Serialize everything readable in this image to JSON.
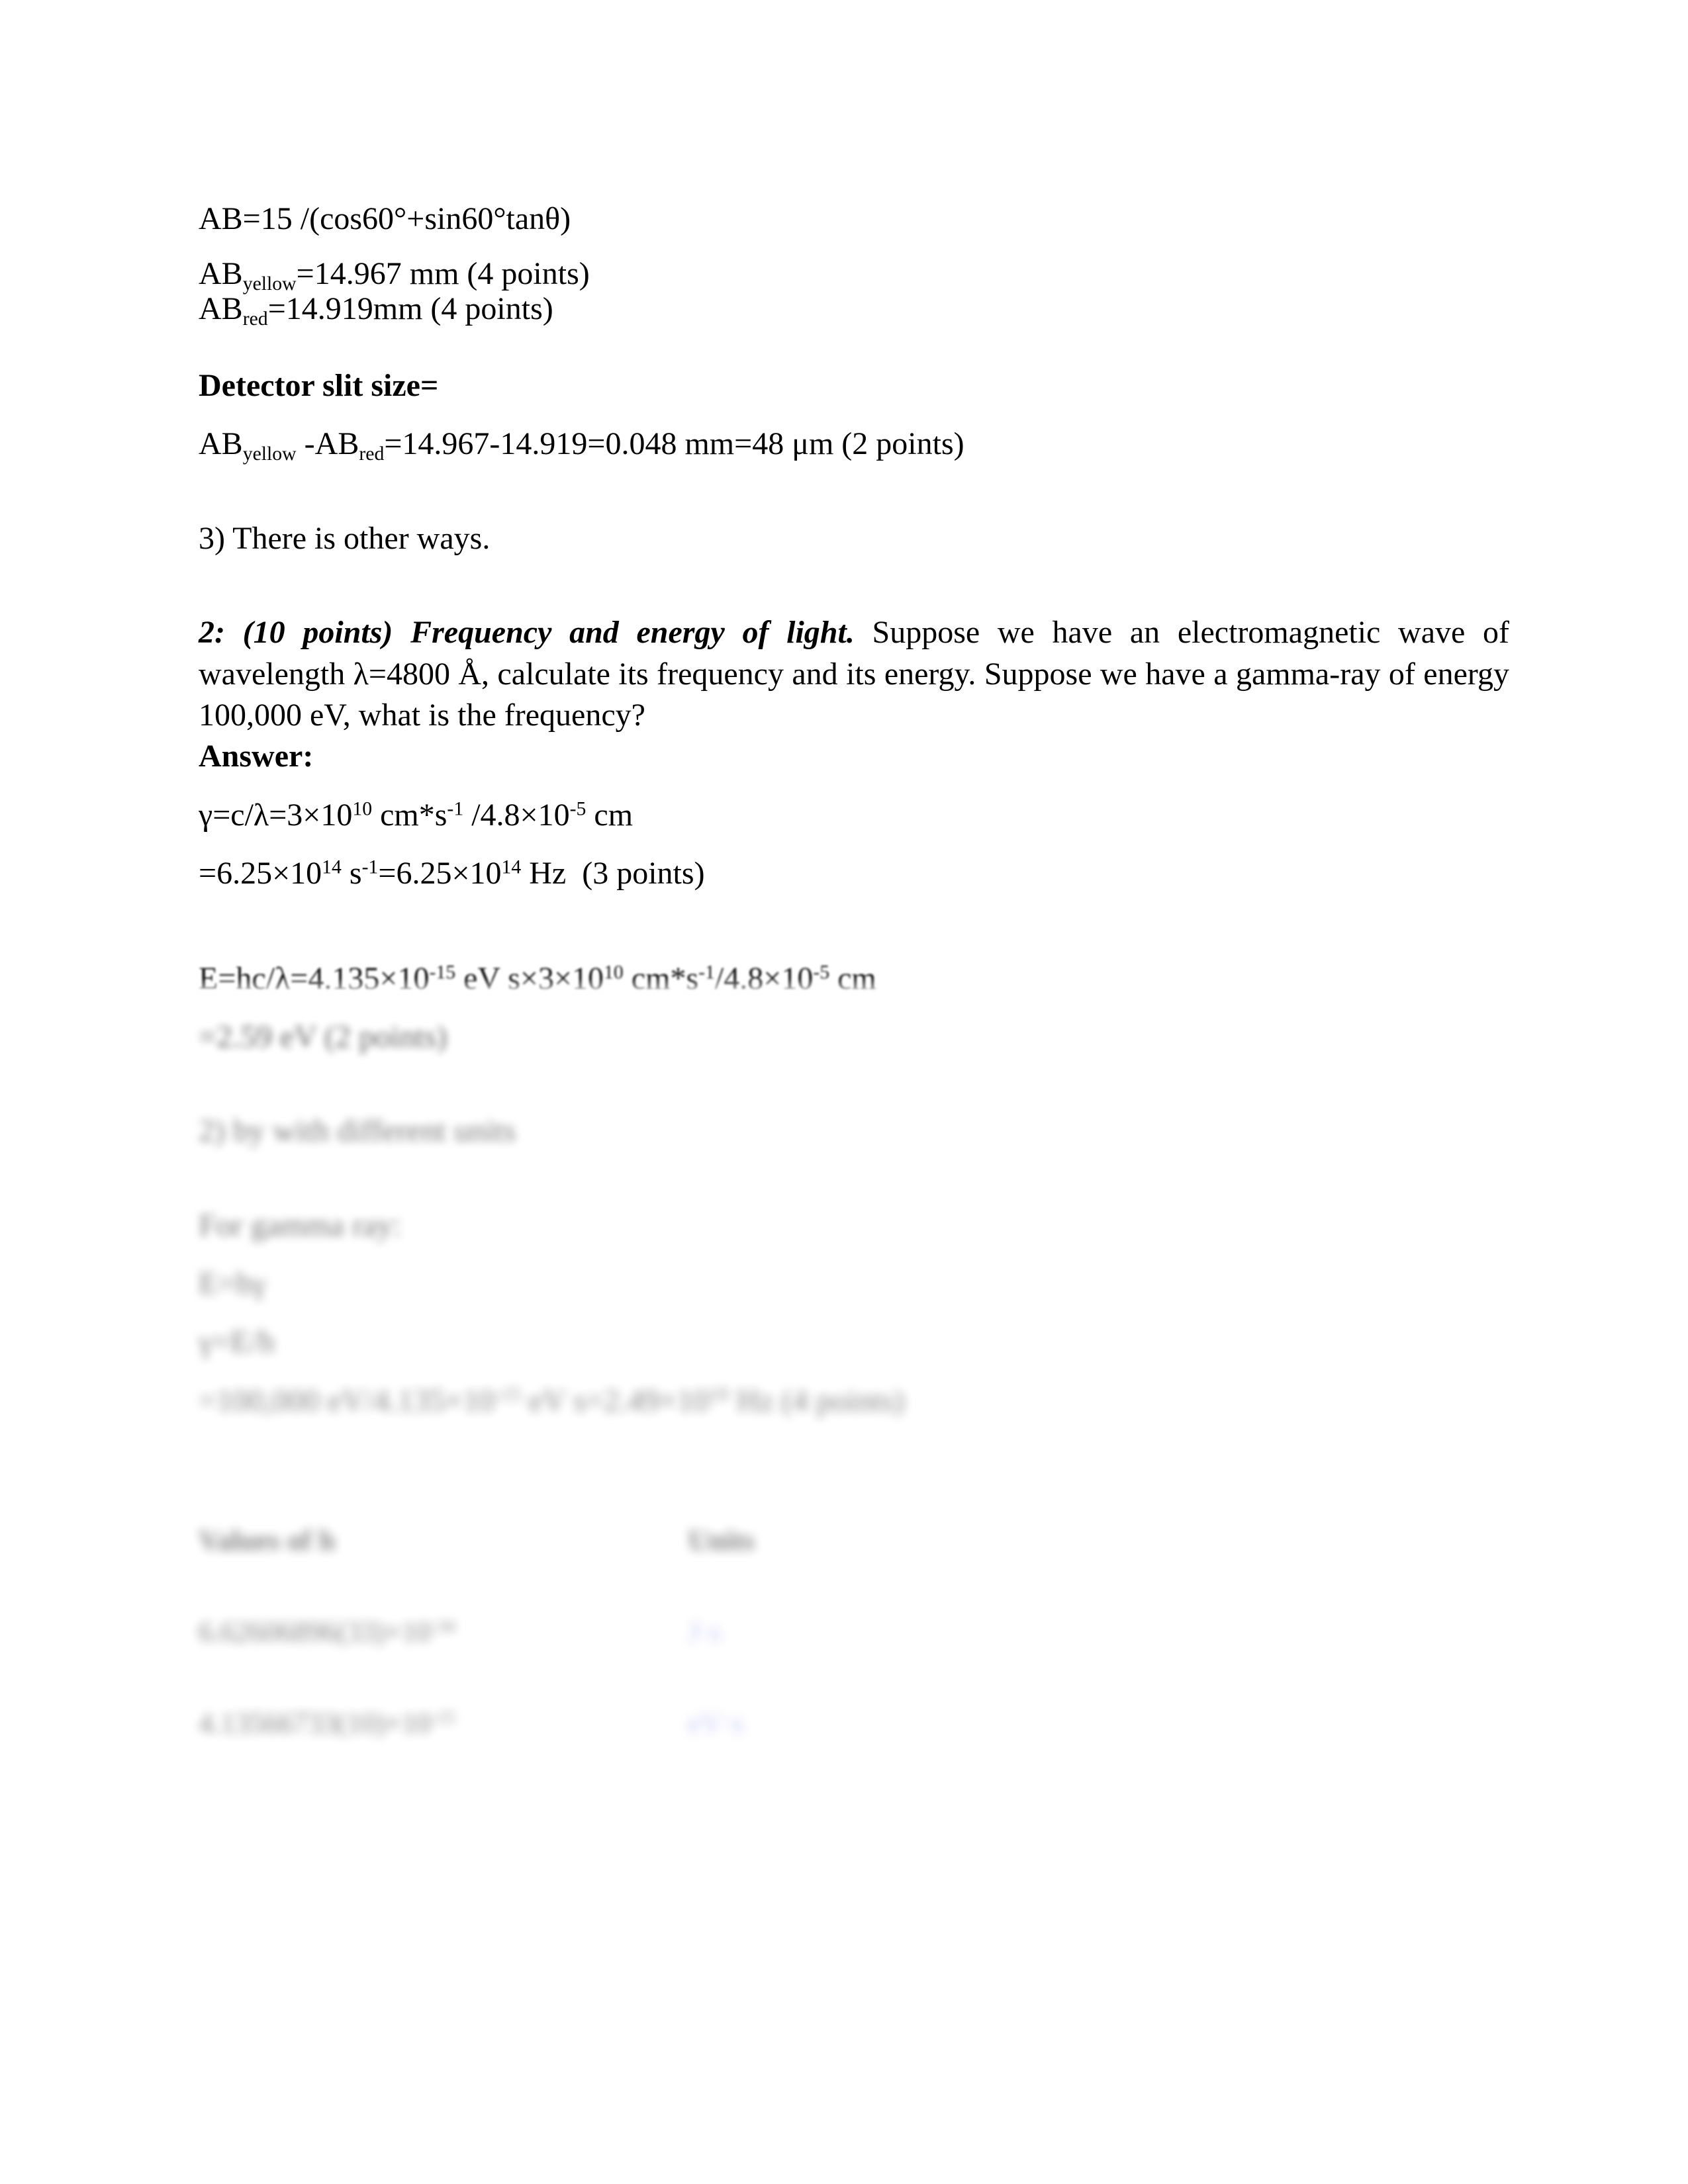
{
  "document": {
    "type": "physics-homework-solution-page",
    "background": "#ffffff",
    "text_color": "#000000",
    "link_color": "#8f8ff0"
  },
  "block1": {
    "formula": "AB=15 /(cos60°+sin60°tanθ)",
    "ab_yellow_label": "AB",
    "ab_yellow_sub": "yellow",
    "ab_yellow_value": "=14.967 mm (4 points)",
    "ab_red_label": "AB",
    "ab_red_sub": "red",
    "ab_red_value": "=14.919mm (4 points)"
  },
  "block2": {
    "heading": "Detector slit size=",
    "lhs_a": "AB",
    "lhs_a_sub": "yellow",
    "lhs_mid": " -AB",
    "lhs_b_sub": "red",
    "rhs": "=14.967-14.919=0.048 mm=48 μm (2 points)"
  },
  "block3": {
    "note": "3) There is other ways."
  },
  "question2": {
    "lead_bold": "2: (10 points) Frequency and energy of light.",
    "body": " Suppose we have an electromagnetic wave of wavelength λ=4800 Å, calculate its frequency and its energy. Suppose we have a gamma-ray of energy 100,000 eV, what is the frequency?",
    "answer_label": "Answer:"
  },
  "freq_calc": {
    "line1_a": "γ=c/λ=3×10",
    "line1_exp1": "10",
    "line1_b": " cm*s",
    "line1_exp2": "-1",
    "line1_c": " /4.8×10",
    "line1_exp3": "-5",
    "line1_d": " cm",
    "line2_a": "=6.25×10",
    "line2_exp1": "14",
    "line2_b": " s",
    "line2_exp2": "-1",
    "line2_c": "=6.25×10",
    "line2_exp3": "14",
    "line2_d": " Hz  (3 points)"
  },
  "energy_calc": {
    "line1_a": "E=hc/λ=4.135×10",
    "line1_exp1": "-15",
    "line1_b": " eV s×3×10",
    "line1_exp2": "10",
    "line1_c": " cm*s",
    "line1_exp3": "-1",
    "line1_d": "/4.8×10",
    "line1_exp4": "-5",
    "line1_e": " cm",
    "line2": "=2.59 eV (2 points)",
    "note": "2) by with different units"
  },
  "gamma_calc": {
    "intro": "For gamma ray:",
    "line1": "E=hγ",
    "line2": "γ=E/h",
    "line3_a": "=100,000 eV/4.135×10",
    "line3_exp1": "-15",
    "line3_b": " eV s=2.49×10",
    "line3_exp2": "19",
    "line3_c": " Hz (4 points)"
  },
  "table": {
    "headers": [
      "Values of h",
      "Units"
    ],
    "rows": [
      {
        "value_mantissa": "6.62606896(33)",
        "value_times": "×10",
        "value_exp": "-34",
        "unit": "J·s"
      },
      {
        "value_mantissa": "4.13566733(10)",
        "value_times": "×10",
        "value_exp": "-15",
        "unit": "eV·s"
      }
    ]
  }
}
